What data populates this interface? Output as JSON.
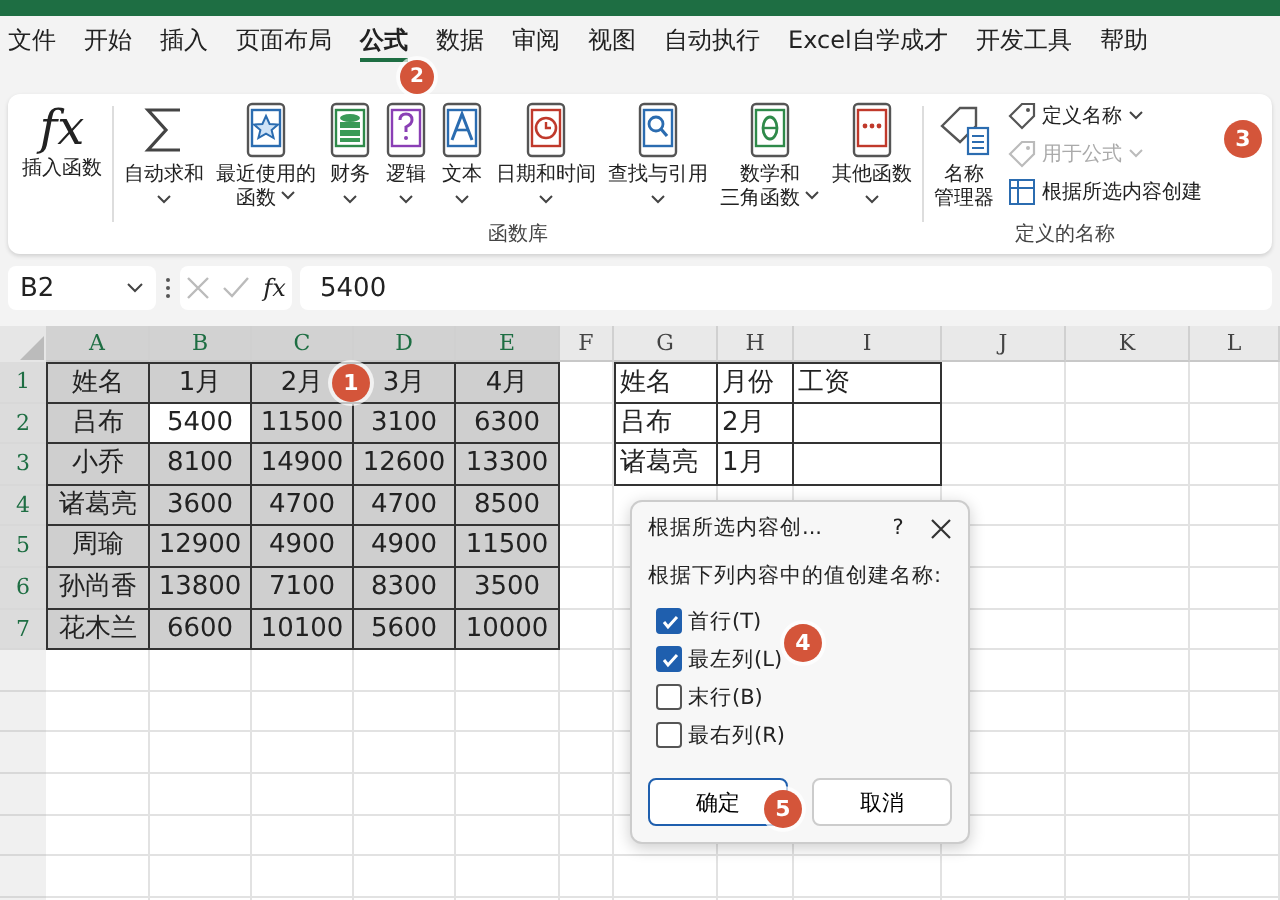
{
  "menu_tabs": [
    {
      "label": "文件",
      "selected": false
    },
    {
      "label": "开始",
      "selected": false
    },
    {
      "label": "插入",
      "selected": false
    },
    {
      "label": "页面布局",
      "selected": false
    },
    {
      "label": "公式",
      "selected": true
    },
    {
      "label": "数据",
      "selected": false
    },
    {
      "label": "审阅",
      "selected": false
    },
    {
      "label": "视图",
      "selected": false
    },
    {
      "label": "自动执行",
      "selected": false
    },
    {
      "label": "Excel自学成才",
      "selected": false
    },
    {
      "label": "开发工具",
      "selected": false
    },
    {
      "label": "帮助",
      "selected": false
    }
  ],
  "ribbon": {
    "insert_function": {
      "symbol": "fx",
      "label": "插入函数"
    },
    "function_library": {
      "title": "函数库",
      "items": [
        {
          "lines": [
            "自动求和"
          ],
          "dropdown": true
        },
        {
          "lines": [
            "最近使用的",
            "函数"
          ],
          "dropdown": true
        },
        {
          "lines": [
            "财务"
          ],
          "dropdown": true
        },
        {
          "lines": [
            "逻辑"
          ],
          "dropdown": true
        },
        {
          "lines": [
            "文本"
          ],
          "dropdown": true
        },
        {
          "lines": [
            "日期和时间"
          ],
          "dropdown": true
        },
        {
          "lines": [
            "查找与引用"
          ],
          "dropdown": true
        },
        {
          "lines": [
            "数学和",
            "三角函数"
          ],
          "dropdown": true
        },
        {
          "lines": [
            "其他函数"
          ],
          "dropdown": true
        }
      ]
    },
    "defined_names": {
      "title": "定义的名称",
      "manager": {
        "lines": [
          "名称",
          "管理器"
        ]
      },
      "commands": [
        {
          "label": "定义名称",
          "dropdown": true,
          "disabled": false
        },
        {
          "label": "用于公式",
          "dropdown": true,
          "disabled": true
        },
        {
          "label": "根据所选内容创建",
          "dropdown": false,
          "disabled": false
        }
      ]
    }
  },
  "formula_bar": {
    "name_box": "B2",
    "symbol": "fx",
    "value": "5400"
  },
  "sheet": {
    "columns": [
      {
        "label": "A",
        "selected": true
      },
      {
        "label": "B",
        "selected": true
      },
      {
        "label": "C",
        "selected": true
      },
      {
        "label": "D",
        "selected": true
      },
      {
        "label": "E",
        "selected": true
      },
      {
        "label": "F",
        "selected": false
      },
      {
        "label": "G",
        "selected": false
      },
      {
        "label": "H",
        "selected": false
      },
      {
        "label": "I",
        "selected": false
      },
      {
        "label": "J",
        "selected": false
      },
      {
        "label": "K",
        "selected": false
      },
      {
        "label": "L",
        "selected": false
      }
    ],
    "rows": [
      {
        "number": "1",
        "selected": true
      },
      {
        "number": "2",
        "selected": true
      },
      {
        "number": "3",
        "selected": true
      },
      {
        "number": "4",
        "selected": true
      },
      {
        "number": "5",
        "selected": true
      },
      {
        "number": "6",
        "selected": true
      },
      {
        "number": "7",
        "selected": true
      }
    ],
    "source_table": [
      [
        {
          "text": "姓名",
          "active": false
        },
        {
          "text": "1月",
          "active": false
        },
        {
          "text": "2月",
          "active": false
        },
        {
          "text": "3月",
          "active": false
        },
        {
          "text": "4月",
          "active": false
        }
      ],
      [
        {
          "text": "吕布",
          "active": false
        },
        {
          "text": "5400",
          "active": true
        },
        {
          "text": "11500",
          "active": false
        },
        {
          "text": "3100",
          "active": false
        },
        {
          "text": "6300",
          "active": false
        }
      ],
      [
        {
          "text": "小乔",
          "active": false
        },
        {
          "text": "8100",
          "active": false
        },
        {
          "text": "14900",
          "active": false
        },
        {
          "text": "12600",
          "active": false
        },
        {
          "text": "13300",
          "active": false
        }
      ],
      [
        {
          "text": "诸葛亮",
          "active": false
        },
        {
          "text": "3600",
          "active": false
        },
        {
          "text": "4700",
          "active": false
        },
        {
          "text": "4700",
          "active": false
        },
        {
          "text": "8500",
          "active": false
        }
      ],
      [
        {
          "text": "周瑜",
          "active": false
        },
        {
          "text": "12900",
          "active": false
        },
        {
          "text": "4900",
          "active": false
        },
        {
          "text": "4900",
          "active": false
        },
        {
          "text": "11500",
          "active": false
        }
      ],
      [
        {
          "text": "孙尚香",
          "active": false
        },
        {
          "text": "13800",
          "active": false
        },
        {
          "text": "7100",
          "active": false
        },
        {
          "text": "8300",
          "active": false
        },
        {
          "text": "3500",
          "active": false
        }
      ],
      [
        {
          "text": "花木兰",
          "active": false
        },
        {
          "text": "6600",
          "active": false
        },
        {
          "text": "10100",
          "active": false
        },
        {
          "text": "5600",
          "active": false
        },
        {
          "text": "10000",
          "active": false
        }
      ]
    ],
    "lookup_table": [
      [
        "姓名",
        "月份",
        "工资"
      ],
      [
        "吕布",
        "2月"
      ],
      [
        "诸葛亮",
        "1月"
      ]
    ]
  },
  "dialog": {
    "title": "根据所选内容创...",
    "help": "?",
    "prompt": "根据下列内容中的值创建名称:",
    "options": [
      {
        "label": "首行(T)",
        "checked": true
      },
      {
        "label": "最左列(L)",
        "checked": true
      },
      {
        "label": "末行(B)",
        "checked": false
      },
      {
        "label": "最右列(R)",
        "checked": false
      }
    ],
    "buttons": [
      {
        "label": "确定",
        "default": true
      },
      {
        "label": "取消",
        "default": false
      }
    ]
  },
  "callouts": [
    "1",
    "2",
    "3",
    "4",
    "5"
  ]
}
